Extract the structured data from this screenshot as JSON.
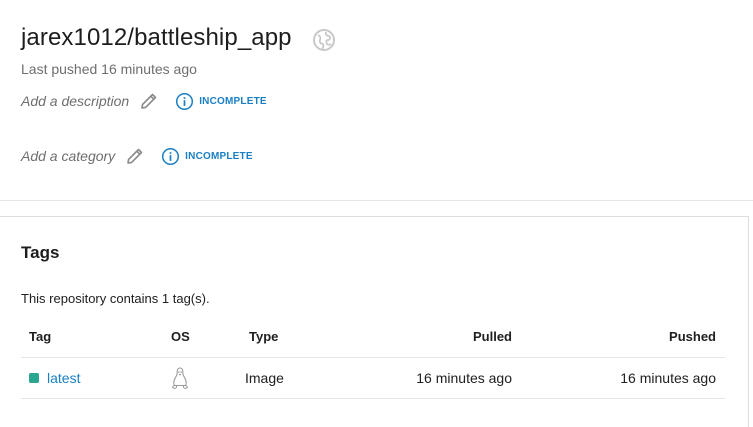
{
  "repo": {
    "name": "jarex1012/battleship_app",
    "last_pushed": "Last pushed 16 minutes ago",
    "visibility_icon": "globe-icon"
  },
  "description": {
    "placeholder": "Add a description",
    "status": "INCOMPLETE"
  },
  "category": {
    "placeholder": "Add a category",
    "status": "INCOMPLETE"
  },
  "tags": {
    "title": "Tags",
    "summary": "This repository contains 1 tag(s).",
    "columns": {
      "tag": "Tag",
      "os": "OS",
      "type": "Type",
      "pulled": "Pulled",
      "pushed": "Pushed"
    },
    "rows": [
      {
        "tag": "latest",
        "os_icon": "linux-icon",
        "type": "Image",
        "pulled": "16 minutes ago",
        "pushed": "16 minutes ago",
        "status_color": "#2ba58f"
      }
    ]
  },
  "colors": {
    "accent": "#1a7fc4",
    "muted_text": "#6e6e6e"
  }
}
